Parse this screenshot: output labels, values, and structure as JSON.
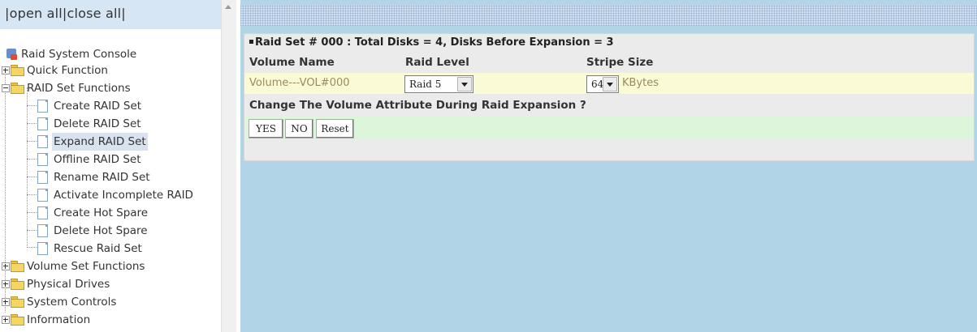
{
  "top_links": {
    "open_all": "open all",
    "close_all": "close all"
  },
  "tree": {
    "root": "Raid System Console",
    "quick_function": "Quick Function",
    "raid_set_functions": "RAID Set Functions",
    "raid_items": [
      "Create RAID Set",
      "Delete RAID Set",
      "Expand RAID Set",
      "Offline RAID Set",
      "Rename RAID Set",
      "Activate Incomplete RAID",
      "Create Hot Spare",
      "Delete Hot Spare",
      "Rescue Raid Set"
    ],
    "volume_set_functions": "Volume Set Functions",
    "physical_drives": "Physical Drives",
    "system_controls": "System Controls",
    "information": "Information"
  },
  "panel": {
    "header": "Raid Set # 000 : Total Disks = 4, Disks Before Expansion = 3",
    "columns": {
      "volume_name": "Volume Name",
      "raid_level": "Raid Level",
      "stripe_size": "Stripe Size"
    },
    "row": {
      "volume": "Volume---VOL#000",
      "raid_level": "Raid 5",
      "stripe_size": "64",
      "stripe_unit": "KBytes"
    },
    "question": "Change The Volume Attribute During Raid Expansion ?",
    "buttons": {
      "yes": "YES",
      "no": "NO",
      "reset": "Reset"
    }
  },
  "colors": {
    "main_bg": "#b1d4e7",
    "top_bar": "#d6e6f4",
    "row_bg": "#fbfad7",
    "button_row": "#dcf6dc"
  }
}
